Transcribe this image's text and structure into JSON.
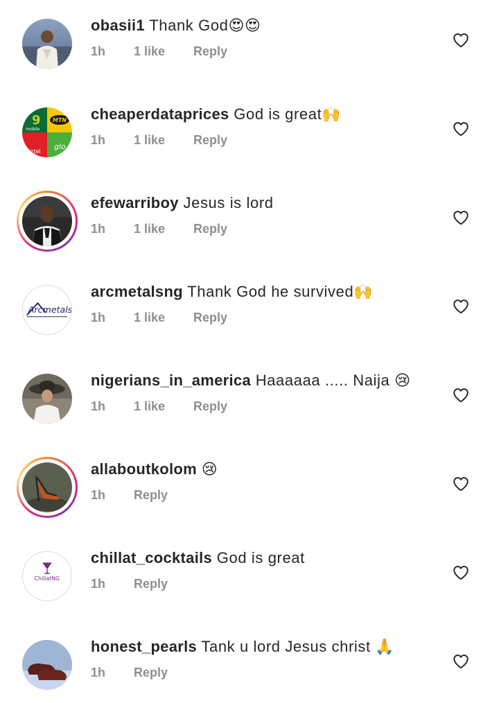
{
  "comments": [
    {
      "username": "obasii1",
      "text": "Thank God😍😍",
      "time": "1h",
      "likes": "1 like",
      "reply": "Reply",
      "avatar": "photo-man-white-shirt-icon"
    },
    {
      "username": "cheaperdataprices",
      "text": "God is great🙌",
      "time": "1h",
      "likes": "1 like",
      "reply": "Reply",
      "avatar": "telecom-logos-icon",
      "avatar_labels": {
        "nine": "9",
        "mobile": "mobile",
        "mtn": "MTN",
        "airtel": "airtel",
        "glo": "glo"
      }
    },
    {
      "username": "efewarriboy",
      "text": "Jesus is lord",
      "time": "1h",
      "likes": "1 like",
      "reply": "Reply",
      "avatar": "photo-man-suit-icon"
    },
    {
      "username": "arcmetalsng",
      "text": "Thank God he survived🙌",
      "time": "1h",
      "likes": "1 like",
      "reply": "Reply",
      "avatar": "arcmetals-logo-icon",
      "avatar_labels": {
        "brand": "Arcmetals"
      }
    },
    {
      "username": "nigerians_in_america",
      "text": "Haaaaaa ..... Naija 😢",
      "time": "1h",
      "likes": "1 like",
      "reply": "Reply",
      "avatar": "photo-woman-hat-icon"
    },
    {
      "username": "allaboutkolom",
      "text": "😢",
      "time": "1h",
      "likes": "",
      "reply": "Reply",
      "avatar": "photo-shoe-icon"
    },
    {
      "username": "chillat_cocktails",
      "text": "God is great",
      "time": "1h",
      "likes": "",
      "reply": "Reply",
      "avatar": "cocktail-logo-icon",
      "avatar_labels": {
        "brand": "ChillatNG"
      }
    },
    {
      "username": "honest_pearls",
      "text": "Tank u lord Jesus christ 🙏",
      "time": "1h",
      "likes": "",
      "reply": "Reply",
      "avatar": "photo-shoes-icon"
    }
  ],
  "colors": {
    "text": "#262626",
    "meta": "#8e8e8e",
    "heart": "#262626"
  }
}
